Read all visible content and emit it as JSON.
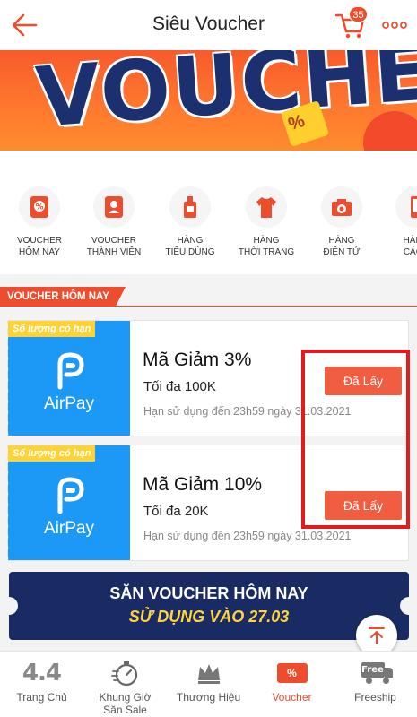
{
  "header": {
    "title": "Siêu Voucher",
    "cart_count": "35"
  },
  "banner": {
    "text": "VOUCHER",
    "badge_symbol": "%"
  },
  "categories": [
    {
      "label": "VOUCHER\nHÔM NAY",
      "icon": "voucher-percent-icon"
    },
    {
      "label": "VOUCHER\nTHÀNH VIÊN",
      "icon": "member-voucher-icon"
    },
    {
      "label": "HÀNG\nTIÊU DÙNG",
      "icon": "consumer-goods-icon"
    },
    {
      "label": "HÀNG\nTHỜI TRANG",
      "icon": "fashion-shirt-icon"
    },
    {
      "label": "HÀNG\nĐIỆN TỬ",
      "icon": "camera-icon"
    },
    {
      "label": "HÀNG \nCÁCH",
      "icon": "phone-icon"
    }
  ],
  "section": {
    "title": "VOUCHER HÔM NAY"
  },
  "vouchers": [
    {
      "tag": "Số lượng có hạn",
      "brand": "AirPay",
      "title": "Mã Giảm 3%",
      "subtitle": "Tối đa 100K",
      "expiry": "Hạn sử dụng đến 23h59 ngày 31.03.2021",
      "button": "Đã Lấy"
    },
    {
      "tag": "Số lượng có hạn",
      "brand": "AirPay",
      "title": "Mã Giảm 10%",
      "subtitle": "Tối đa 20K",
      "expiry": "Hạn sử dụng đến 23h59 ngày 31.03.2021",
      "button": "Đã Lấy"
    }
  ],
  "bottom_banner": {
    "line1": "SĂN VOUCHER HÔM NAY",
    "line2": "SỬ DỤNG VÀO 27.03"
  },
  "nav": [
    {
      "label": "Trang Chủ",
      "icon": "home-44-icon",
      "active": false
    },
    {
      "label": "Khung Giờ\nSăn Sale",
      "icon": "stopwatch-icon",
      "active": false
    },
    {
      "label": "Thương Hiệu",
      "icon": "crown-icon",
      "active": false
    },
    {
      "label": "Voucher",
      "icon": "voucher-icon",
      "active": true
    },
    {
      "label": "Freeship",
      "icon": "free-truck-icon",
      "active": false
    }
  ],
  "nav_icon_text": {
    "home": "4.4",
    "voucher": "%",
    "freeship": "Free"
  },
  "colors": {
    "accent": "#ee4d2d",
    "airpay": "#1c98f7",
    "tag": "#ffd336",
    "highlight_box": "#e41b1b"
  }
}
